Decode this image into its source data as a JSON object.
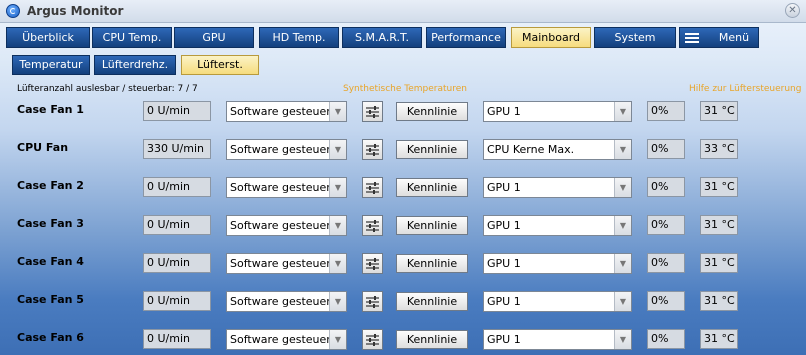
{
  "window": {
    "title": "Argus Monitor",
    "close_label": "✕"
  },
  "tabs": [
    {
      "label": "Überblick",
      "active": false
    },
    {
      "label": "CPU Temp.",
      "active": false
    },
    {
      "label": "GPU",
      "active": false
    },
    {
      "label": "HD Temp.",
      "active": false
    },
    {
      "label": "S.M.A.R.T.",
      "active": false
    },
    {
      "label": "Performance",
      "active": false
    },
    {
      "label": "Mainboard",
      "active": true
    },
    {
      "label": "System",
      "active": false
    },
    {
      "label": "Menü",
      "active": false
    }
  ],
  "subtabs": [
    {
      "label": "Temperatur",
      "active": false
    },
    {
      "label": "Lüfterdrehz.",
      "active": false
    },
    {
      "label": "Lüfterst.",
      "active": true
    }
  ],
  "info": {
    "fan_count": "Lüfteranzahl auslesbar / steuerbar: 7 / 7",
    "synthetic_link": "Synthetische Temperaturen",
    "help_link": "Hilfe zur Lüftersteuerung"
  },
  "fans": [
    {
      "name": "Case Fan 1",
      "rpm": "0 U/min",
      "mode": "Software gesteuert",
      "curve_label": "Kennlinie",
      "source": "GPU 1",
      "percent": "0%",
      "temp": "31 °C"
    },
    {
      "name": "CPU Fan",
      "rpm": "330 U/min",
      "mode": "Software gesteuert",
      "curve_label": "Kennlinie",
      "source": "CPU Kerne Max.",
      "percent": "0%",
      "temp": "33 °C"
    },
    {
      "name": "Case Fan 2",
      "rpm": "0 U/min",
      "mode": "Software gesteuert",
      "curve_label": "Kennlinie",
      "source": "GPU 1",
      "percent": "0%",
      "temp": "31 °C"
    },
    {
      "name": "Case Fan 3",
      "rpm": "0 U/min",
      "mode": "Software gesteuert",
      "curve_label": "Kennlinie",
      "source": "GPU 1",
      "percent": "0%",
      "temp": "31 °C"
    },
    {
      "name": "Case Fan 4",
      "rpm": "0 U/min",
      "mode": "Software gesteuert",
      "curve_label": "Kennlinie",
      "source": "GPU 1",
      "percent": "0%",
      "temp": "31 °C"
    },
    {
      "name": "Case Fan 5",
      "rpm": "0 U/min",
      "mode": "Software gesteuert",
      "curve_label": "Kennlinie",
      "source": "GPU 1",
      "percent": "0%",
      "temp": "31 °C"
    },
    {
      "name": "Case Fan 6",
      "rpm": "0 U/min",
      "mode": "Software gesteuert",
      "curve_label": "Kennlinie",
      "source": "GPU 1",
      "percent": "0%",
      "temp": "31 °C"
    }
  ],
  "colors": {
    "tab_bg": "#1e4f95",
    "tab_active_bg": "#f6dc7e",
    "link": "#e8a52a",
    "field_bg": "#d6dbe2"
  }
}
